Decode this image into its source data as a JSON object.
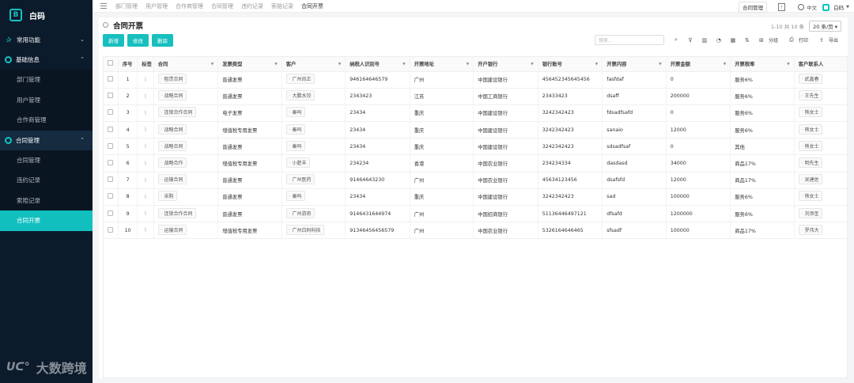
{
  "app": {
    "name": "白码"
  },
  "sidebar": {
    "groups": [
      {
        "label": "常用功能",
        "expanded": false
      },
      {
        "label": "基础信息",
        "expanded": true,
        "items": [
          "部门管理",
          "用户管理",
          "合作商管理"
        ]
      },
      {
        "label": "合同管理",
        "expanded": true,
        "items": [
          "合同管理",
          "违约记录",
          "索赔记录",
          "合同开票"
        ]
      }
    ],
    "active_item": "合同开票"
  },
  "watermark": "大数跨境",
  "topbar": {
    "breadcrumbs": [
      "部门管理",
      "用户管理",
      "合作商管理",
      "合同管理",
      "违约记录",
      "索赔记录",
      "合同开票"
    ],
    "button": "合同管理",
    "language": "中文",
    "user": "白码"
  },
  "page": {
    "title": "合同开票",
    "pager_text": "1-10 共 10 条",
    "page_size": "20 条/页"
  },
  "actions": {
    "add": "新增",
    "edit": "修改",
    "delete": "删除"
  },
  "toolbar": {
    "search_placeholder": "搜索...",
    "group": "分组",
    "print": "打印",
    "export": "导出"
  },
  "table": {
    "columns": [
      "序号",
      "标签",
      "合同",
      "发票类型",
      "客户",
      "纳税人识别号",
      "开票地址",
      "开户银行",
      "银行账号",
      "开票内容",
      "开票金额",
      "开票税率",
      "客户联系人"
    ],
    "rows": [
      [
        "1",
        "租赁合同",
        "普通发票",
        "广州尚正",
        "946164646579",
        "广州",
        "中国建设银行",
        "456452345645456",
        "fasfdaf",
        "0",
        "服务6%",
        "武鑫春"
      ],
      [
        "2",
        "战略合同",
        "普通发票",
        "大鹏水饺",
        "2343423",
        "江苏",
        "中国工商银行",
        "23433423",
        "dsaff",
        "200000",
        "服务6%",
        "王先生"
      ],
      [
        "3",
        "连锁合作合同",
        "电子发票",
        "秦吗",
        "23434",
        "重庆",
        "中国建设银行",
        "3242342423",
        "fdsadfsafd",
        "0",
        "服务6%",
        "熊女士"
      ],
      [
        "4",
        "战略合同",
        "增值税专用发票",
        "秦吗",
        "23434",
        "重庆",
        "中国建设银行",
        "3242342423",
        "sanaio",
        "12000",
        "服务6%",
        "熊女士"
      ],
      [
        "5",
        "战略合同",
        "普通发票",
        "秦吗",
        "23434",
        "重庆",
        "中国建设银行",
        "3242342423",
        "sdsadfsaf",
        "0",
        "其他",
        "熊女士"
      ],
      [
        "6",
        "战略合作",
        "增值税专用发票",
        "小肥羊",
        "234234",
        "香港",
        "中国农业银行",
        "234234334",
        "dasdasd",
        "34000",
        "商品17%",
        "明先生"
      ],
      [
        "7",
        "运输合同",
        "普通发票",
        "广州医药",
        "91464643230",
        "广州",
        "中国农业银行",
        "45634123456",
        "dsafsfd",
        "12000",
        "商品17%",
        "吴建佐"
      ],
      [
        "8",
        "采购",
        "普通发票",
        "秦吗",
        "23434",
        "重庆",
        "中国建设银行",
        "3242342423",
        "sad",
        "100000",
        "服务6%",
        "熊女士"
      ],
      [
        "9",
        "连锁合作合同",
        "普通发票",
        "广州游奇",
        "9146431644974",
        "广州",
        "中国招商银行",
        "51136446497121",
        "dfsafd",
        "1200000",
        "服务6%",
        "刘添圣"
      ],
      [
        "10",
        "运输合同",
        "增值税专用发票",
        "广州白码科技",
        "91346456456579",
        "广州",
        "中国农业银行",
        "5326164646465",
        "sfsadf",
        "100000",
        "商品17%",
        "罗伟大"
      ]
    ]
  },
  "colors": {
    "accent": "#17bfbf",
    "sidebar_bg": "#0c1b2c"
  }
}
